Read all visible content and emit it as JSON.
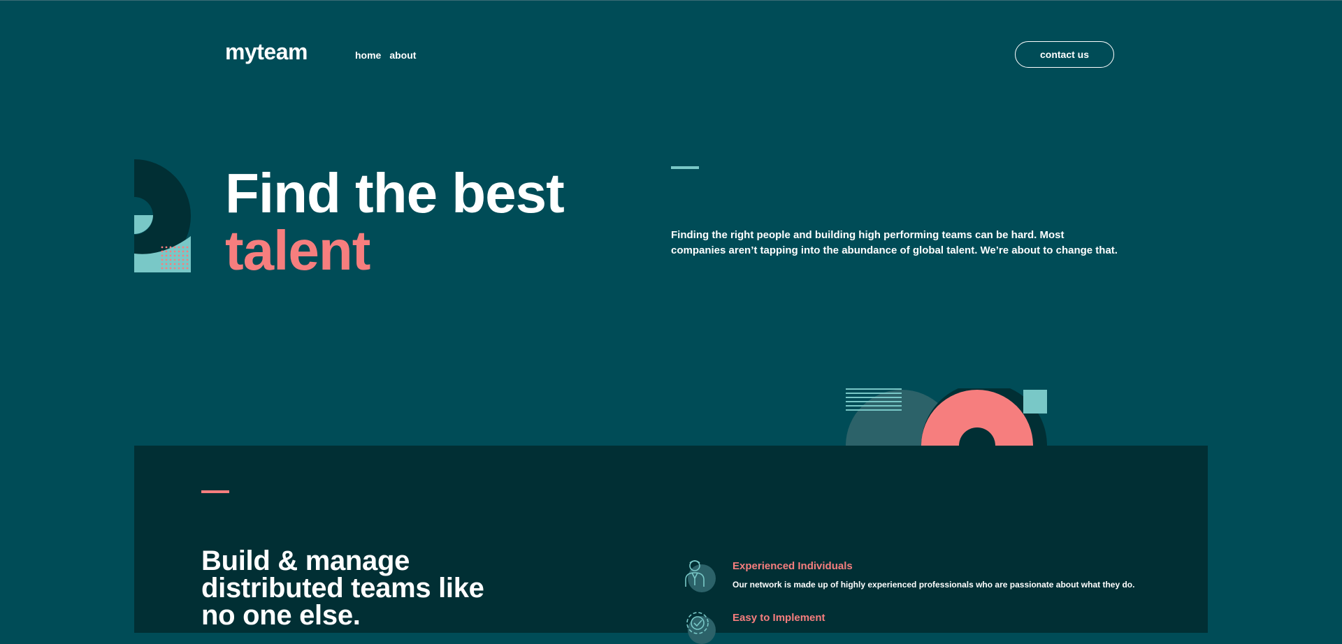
{
  "header": {
    "logo": "myteam",
    "nav": [
      {
        "label": "home"
      },
      {
        "label": "about"
      }
    ],
    "contact_label": "contact us"
  },
  "hero": {
    "title_line1": "Find the best",
    "title_line2": "talent",
    "description": "Finding the right people and building high performing teams can be hard. Most companies aren’t tapping into the abundance of global talent. We’re about to change that."
  },
  "features_section": {
    "title": "Build & manage distributed teams like no one else.",
    "features": [
      {
        "icon": "person-icon",
        "title": "Experienced Individuals",
        "description": "Our network is made up of highly experienced professionals who are passionate about what they do."
      },
      {
        "icon": "cog-check-icon",
        "title": "Easy to Implement",
        "description": ""
      }
    ]
  },
  "colors": {
    "background": "#004c57",
    "dark_section": "#012f34",
    "accent_coral": "#f67e7e",
    "accent_teal": "#79c8c7",
    "dark_green": "#002529"
  }
}
